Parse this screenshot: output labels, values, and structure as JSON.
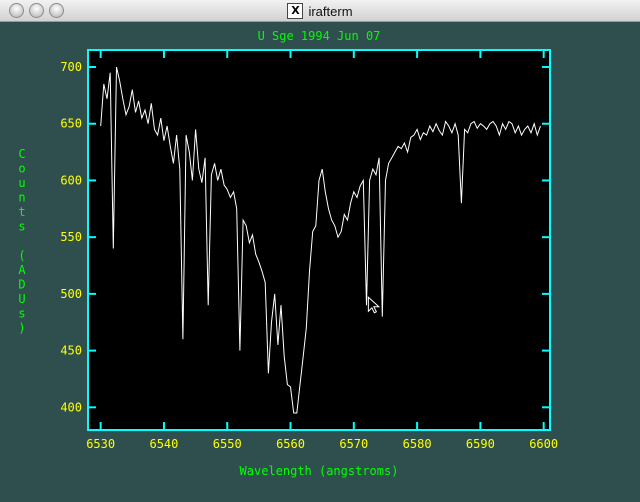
{
  "window": {
    "title": "irafterm",
    "icon": "x11-icon",
    "icon_glyph": "X",
    "controls": [
      "close",
      "minimize",
      "zoom"
    ]
  },
  "colors": {
    "background": "#2f4f4f",
    "axes": "#00ffff",
    "plot_bg": "#000000",
    "trace": "#ffffff",
    "tick_labels": "#ffff00",
    "axis_titles": "#00ff00"
  },
  "chart_data": {
    "type": "line",
    "title": "U Sge 1994 Jun 07",
    "xlabel": "Wavelength (angstroms)",
    "ylabel": "Counts (ADUs)",
    "xlim": [
      6528,
      6601
    ],
    "ylim": [
      380,
      715
    ],
    "xticks": [
      6530,
      6540,
      6550,
      6560,
      6570,
      6580,
      6590,
      6600
    ],
    "yticks": [
      400,
      450,
      500,
      550,
      600,
      650,
      700
    ],
    "grid": false,
    "series": [
      {
        "x": [
          6530.0,
          6530.5,
          6531.0,
          6531.5,
          6532.0,
          6532.5,
          6533.0,
          6533.5,
          6534.0,
          6534.5,
          6535.0,
          6535.5,
          6536.0,
          6536.5,
          6537.0,
          6537.5,
          6538.0,
          6538.5,
          6539.0,
          6539.5,
          6540.0,
          6540.5,
          6541.0,
          6541.5,
          6542.0,
          6542.5,
          6543.0,
          6543.5,
          6544.0,
          6544.5,
          6545.0,
          6545.5,
          6546.0,
          6546.5,
          6547.0,
          6547.5,
          6548.0,
          6548.5,
          6549.0,
          6549.5,
          6550.0,
          6550.5,
          6551.0,
          6551.5,
          6552.0,
          6552.5,
          6553.0,
          6553.5,
          6554.0,
          6554.5,
          6555.0,
          6555.5,
          6556.0,
          6556.5,
          6557.0,
          6557.5,
          6558.0,
          6558.5,
          6559.0,
          6559.5,
          6560.0,
          6560.5,
          6561.0,
          6561.5,
          6562.0,
          6562.5,
          6563.0,
          6563.5,
          6564.0,
          6564.5,
          6565.0,
          6565.5,
          6566.0,
          6566.5,
          6567.0,
          6567.5,
          6568.0,
          6568.5,
          6569.0,
          6569.5,
          6570.0,
          6570.5,
          6571.0,
          6571.5,
          6572.0,
          6572.5,
          6573.0,
          6573.5,
          6574.0,
          6574.5,
          6575.0,
          6575.5,
          6576.0,
          6576.5,
          6577.0,
          6577.5,
          6578.0,
          6578.5,
          6579.0,
          6579.5,
          6580.0,
          6580.5,
          6581.0,
          6581.5,
          6582.0,
          6582.5,
          6583.0,
          6583.5,
          6584.0,
          6584.5,
          6585.0,
          6585.5,
          6586.0,
          6586.5,
          6587.0,
          6587.5,
          6588.0,
          6588.5,
          6589.0,
          6589.5,
          6590.0,
          6590.5,
          6591.0,
          6591.5,
          6592.0,
          6592.5,
          6593.0,
          6593.5,
          6594.0,
          6594.5,
          6595.0,
          6595.5,
          6596.0,
          6596.5,
          6597.0,
          6597.5,
          6598.0,
          6598.5,
          6599.0,
          6599.5
        ],
        "y": [
          648,
          685,
          672,
          695,
          540,
          700,
          688,
          672,
          658,
          665,
          680,
          660,
          670,
          655,
          662,
          650,
          668,
          645,
          640,
          655,
          635,
          648,
          630,
          615,
          640,
          610,
          460,
          640,
          625,
          600,
          645,
          610,
          598,
          620,
          490,
          605,
          615,
          600,
          610,
          596,
          592,
          585,
          590,
          575,
          450,
          565,
          560,
          545,
          552,
          535,
          528,
          520,
          510,
          430,
          475,
          500,
          455,
          490,
          445,
          420,
          418,
          395,
          395,
          420,
          445,
          470,
          520,
          555,
          560,
          600,
          610,
          590,
          575,
          565,
          560,
          550,
          555,
          570,
          565,
          580,
          590,
          585,
          595,
          600,
          490,
          600,
          610,
          605,
          620,
          480,
          600,
          615,
          620,
          625,
          630,
          628,
          633,
          625,
          638,
          640,
          645,
          636,
          642,
          640,
          648,
          643,
          650,
          644,
          640,
          652,
          648,
          642,
          650,
          640,
          580,
          645,
          642,
          650,
          652,
          646,
          650,
          648,
          645,
          650,
          652,
          648,
          640,
          650,
          645,
          652,
          650,
          642,
          648,
          640,
          645,
          648,
          642,
          650,
          640,
          648
        ]
      }
    ],
    "annotations": [
      {
        "type": "cursor",
        "x": 6572.3,
        "y": 497
      }
    ]
  }
}
